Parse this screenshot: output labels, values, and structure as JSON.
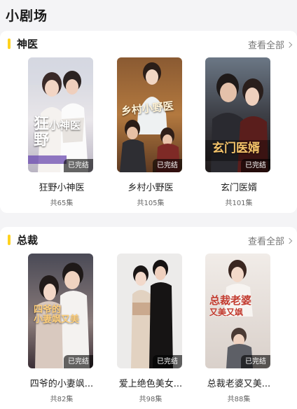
{
  "page": {
    "title": "小剧场"
  },
  "sections": [
    {
      "title": "神医",
      "view_all": "查看全部",
      "dramas": [
        {
          "title": "狂野小神医",
          "episodes": "共65集",
          "status": "已完结",
          "poster_text": "狂野小神医"
        },
        {
          "title": "乡村小野医",
          "episodes": "共105集",
          "status": "已完结",
          "poster_text": "乡村小野医"
        },
        {
          "title": "玄门医婿",
          "episodes": "共101集",
          "status": "已完结",
          "poster_text": "玄门医婿"
        }
      ]
    },
    {
      "title": "总裁",
      "view_all": "查看全部",
      "dramas": [
        {
          "title": "四爷的小妻飒...",
          "episodes": "共82集",
          "status": "已完结",
          "poster_text": "四爷的小妻飒又美"
        },
        {
          "title": "爱上绝色美女...",
          "episodes": "共98集",
          "status": "已完结",
          "poster_text": ""
        },
        {
          "title": "总裁老婆又美...",
          "episodes": "共88集",
          "status": "已完结",
          "poster_text": "总裁老婆又美又飒"
        }
      ]
    }
  ],
  "colors": {
    "accent": "#ffd21e",
    "background": "#f4f4f6",
    "card_background": "#ffffff"
  },
  "icons": {
    "view_all": "chevron-right-icon"
  }
}
